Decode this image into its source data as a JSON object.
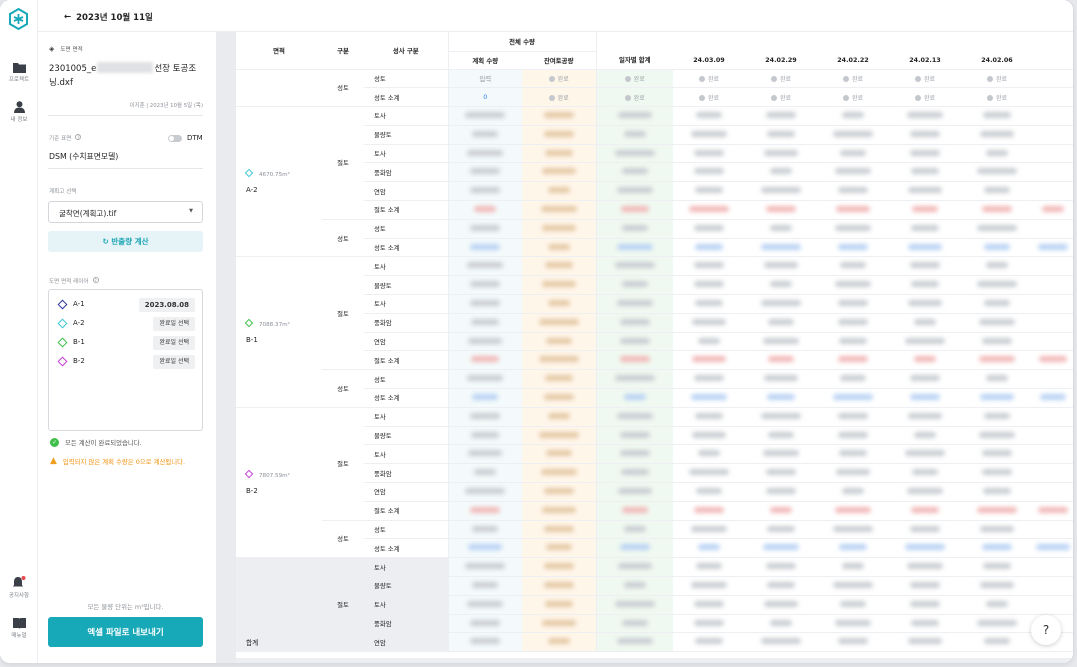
{
  "nav": {
    "projects": "프로젝트",
    "my_info": "내 정보",
    "notice": "공지사항",
    "manual": "매뉴얼"
  },
  "topbar": {
    "back_label": "2023년 10월 11일"
  },
  "panel": {
    "drawing_label": "도면 면적",
    "file_prefix": "2301005_e",
    "file_suffix": "선장 토공조",
    "file_line2": "닝.dxf",
    "meta": "이지훈  |  2023년 10월 5일 (목)",
    "ref_surface_label": "기준 표면",
    "dtm_label": "DTM",
    "ref_surface_value": "DSM (수치표면모델)",
    "plan_select_label": "계획고 선택",
    "plan_select_value": "굴착면(계획고).tif",
    "calc_button": "반출량 계산",
    "layer_label": "도면 면적 레이어",
    "layers": [
      {
        "name": "A-1",
        "tag": "2023.08.08",
        "color": "#2f3a9c"
      },
      {
        "name": "A-2",
        "tag": "완료일 선택",
        "color": "#3fc6d8"
      },
      {
        "name": "B-1",
        "tag": "완료일 선택",
        "color": "#3fbf4a"
      },
      {
        "name": "B-2",
        "tag": "완료일 선택",
        "color": "#c63fd8"
      }
    ],
    "note_ok": "모든 계산이 완료되었습니다.",
    "note_warn": "입력되지 않은 계획 수량은 0으로 계산됩니다.",
    "units_note": "모든 물량 단위는 m³입니다.",
    "export_button": "엑셀 파일로 내보내기"
  },
  "table": {
    "headers": {
      "area": "면적",
      "group": "구분",
      "class": "성사 구분",
      "total": "전체 수량",
      "plan": "계획 수량",
      "remain": "잔여토공량",
      "daily": "일자별 합계",
      "dates": [
        "24.03.09",
        "24.02.29",
        "24.02.22",
        "24.02.13",
        "24.02.06"
      ]
    },
    "top": {
      "cls": [
        "성토",
        "성토 소계"
      ],
      "group": "성토",
      "plan_values": [
        "입력",
        "0"
      ],
      "done": "완료"
    },
    "areas": [
      {
        "name": "A-2",
        "area": "4670.75m²",
        "color": "#3fc6d8"
      },
      {
        "name": "B-1",
        "area": "7088.37m²",
        "color": "#3fbf4a"
      },
      {
        "name": "B-2",
        "area": "7807.59m²",
        "color": "#c63fd8"
      }
    ],
    "cut_label": "절토",
    "fill_label": "성토",
    "cut_rows": [
      "토사",
      "물량토",
      "토사",
      "풍화암",
      "연암",
      "절토 소계"
    ],
    "fill_rows": [
      "성토",
      "성토 소계"
    ],
    "total_label": "합계",
    "total_rows": [
      "토사",
      "물량토",
      "토사",
      "풍화암",
      "연암"
    ]
  },
  "help": "?"
}
